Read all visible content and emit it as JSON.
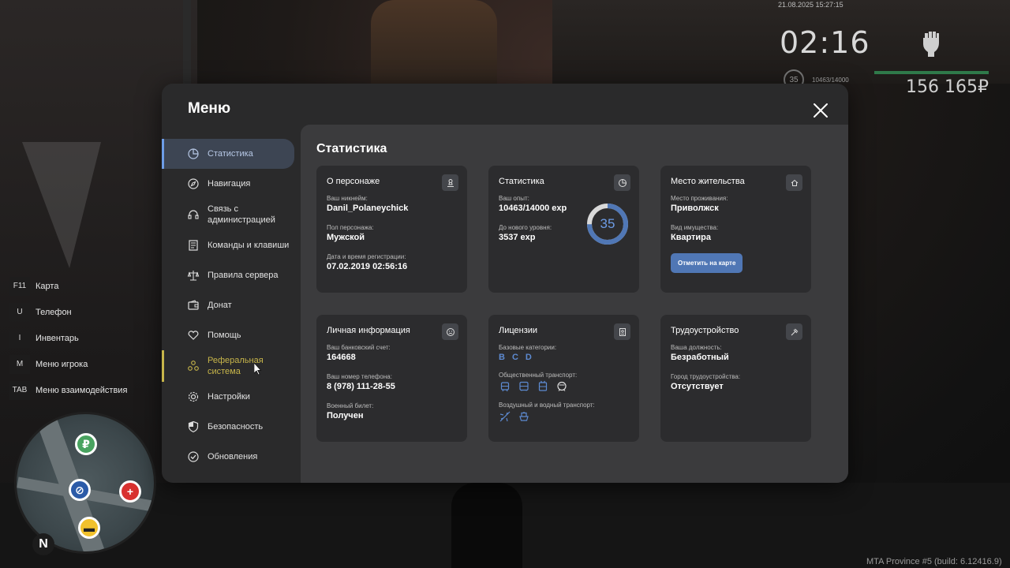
{
  "hud": {
    "datetime": "21.08.2025 15:27:15",
    "clock": "02:16",
    "level": "35",
    "exp": "10463/14000",
    "money": "156 165₽",
    "build_info": "MTA Province #5 (build: 6.12416.9)"
  },
  "keys": [
    {
      "key": "F11",
      "label": "Карта"
    },
    {
      "key": "U",
      "label": "Телефон"
    },
    {
      "key": "I",
      "label": "Инвентарь"
    },
    {
      "key": "M",
      "label": "Меню игрока"
    },
    {
      "key": "TAB",
      "label": "Меню взаимодействия"
    }
  ],
  "minimap": {
    "north": "N",
    "blips": [
      "ruble-icon",
      "hospital-icon",
      "taxi-icon",
      "police-icon"
    ]
  },
  "menu": {
    "title": "Меню",
    "nav": [
      {
        "label": "Статистика",
        "icon": "stats-icon",
        "active": true
      },
      {
        "label": "Навигация",
        "icon": "compass-icon"
      },
      {
        "label": "Связь с администрацией",
        "icon": "headset-icon"
      },
      {
        "label": "Команды и клавиши",
        "icon": "list-icon"
      },
      {
        "label": "Правила сервера",
        "icon": "scales-icon"
      },
      {
        "label": "Донат",
        "icon": "wallet-icon"
      },
      {
        "label": "Помощь",
        "icon": "heart-hand-icon"
      },
      {
        "label": "Реферальная система",
        "icon": "referral-icon",
        "highlight": "#c7b54a"
      },
      {
        "label": "Настройки",
        "icon": "gear-icon"
      },
      {
        "label": "Безопасность",
        "icon": "shield-icon"
      },
      {
        "label": "Обновления",
        "icon": "update-icon"
      }
    ]
  },
  "content": {
    "title": "Статистика",
    "character": {
      "title": "О персонаже",
      "nick_label": "Ваш никнейм:",
      "nick": "Danil_Polaneychick",
      "gender_label": "Пол персонажа:",
      "gender": "Мужской",
      "reg_label": "Дата и время регистрации:",
      "reg": "07.02.2019 02:56:16"
    },
    "stats": {
      "title": "Статистика",
      "exp_label": "Ваш опыт:",
      "exp": "10463/14000 exp",
      "next_label": "До нового уровня:",
      "next": "3537 exp",
      "level": "35",
      "progress": 0.747
    },
    "residence": {
      "title": "Место жительства",
      "place_label": "Место проживания:",
      "place": "Приволжск",
      "property_label": "Вид имущества:",
      "property": "Квартира",
      "button": "Отметить на карте"
    },
    "personal": {
      "title": "Личная информация",
      "bank_label": "Ваш банковский счет:",
      "bank": "164668",
      "phone_label": "Ваш номер телефона:",
      "phone": "8 (978) 111-28-55",
      "military_label": "Военный билет:",
      "military": "Получен"
    },
    "licenses": {
      "title": "Лицензии",
      "basic_label": "Базовые категории:",
      "categories": [
        "B",
        "C",
        "D"
      ],
      "public_label": "Общественный транспорт:",
      "air_label": "Воздушный и водный транспорт:"
    },
    "employment": {
      "title": "Трудоустройство",
      "position_label": "Ваша должность:",
      "position": "Безработный",
      "city_label": "Город трудоустройства:",
      "city": "Отсутствует"
    }
  },
  "colors": {
    "accent": "#6d9ce6",
    "referral": "#c7b54a",
    "button": "#5077b5",
    "panel": "#2a2a2b",
    "card": "#2c2c2e"
  }
}
